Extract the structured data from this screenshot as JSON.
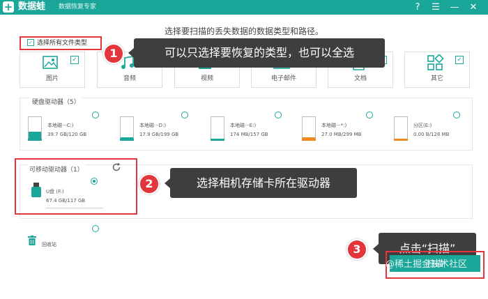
{
  "app": {
    "logo_glyph": "+",
    "name": "数据蛙",
    "subtitle": "数据恢复专家"
  },
  "window_controls": {
    "help": "?",
    "menu": "☰",
    "minimize": "—",
    "close": "✕"
  },
  "instruction": "选择要扫描的丢失数据的数据类型和路径。",
  "select_all": {
    "label": "选择所有文件类型",
    "checked": true
  },
  "file_types": [
    {
      "label": "图片",
      "icon": "image-icon",
      "checked": true
    },
    {
      "label": "音频",
      "icon": "music-icon",
      "checked": true
    },
    {
      "label": "视频",
      "icon": "video-icon",
      "checked": true
    },
    {
      "label": "电子邮件",
      "icon": "mail-icon",
      "checked": true
    },
    {
      "label": "文档",
      "icon": "document-icon",
      "checked": true
    },
    {
      "label": "其它",
      "icon": "other-icon",
      "checked": true
    }
  ],
  "hard_drives": {
    "title": "硬盘驱动器（5）",
    "items": [
      {
        "name": "本地磁···C:)",
        "size": "39.7 GB/120 GB",
        "fill": 0.33,
        "color": "#1aa79a"
      },
      {
        "name": "本地磁···D:)",
        "size": "17.9 GB/199 GB",
        "fill": 0.09,
        "color": "#1aa79a"
      },
      {
        "name": "本地磁···E:)",
        "size": "174 MB/157 GB",
        "fill": 0.01,
        "color": "#1aa79a"
      },
      {
        "name": "本地磁···*:)",
        "size": "27.0 MB/299 MB",
        "fill": 0.09,
        "color": "#f08a1c"
      },
      {
        "name": "分区(E:)",
        "size": "0.00  B/128 MB",
        "fill": 0.0,
        "color": "#f08a1c"
      }
    ]
  },
  "removable": {
    "title": "可移动驱动器（1）",
    "refresh_icon": "refresh-icon",
    "drive": {
      "name": "U盘 (F:)",
      "size": "67.4 GB/117 GB",
      "selected": true
    }
  },
  "recycle_bin": {
    "label": "回收站",
    "icon": "trash-icon"
  },
  "callouts": [
    {
      "number": "1",
      "text": "可以只选择要恢复的类型，也可以全选"
    },
    {
      "number": "2",
      "text": "选择相机存储卡所在驱动器"
    },
    {
      "number": "3",
      "text": "点击“扫描”"
    }
  ],
  "scan_button": {
    "label": "扫描"
  },
  "watermark": "@稀土掘金技术社区",
  "colors": {
    "accent": "#1aa79a",
    "highlight": "#e2363c",
    "callout_bg": "#3e3e3e"
  }
}
